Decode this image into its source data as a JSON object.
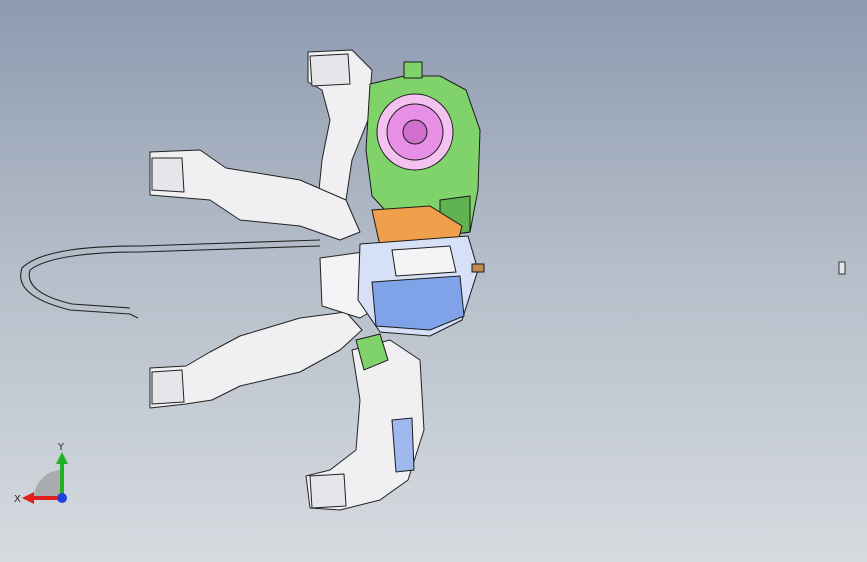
{
  "viewport": {
    "background_top": "#8e9bb0",
    "background_bottom": "#d7dbe0"
  },
  "model_colors": {
    "blower_housing": "#7fd36a",
    "blower_wheel": "#e88fe6",
    "core_blue": "#7fa2e8",
    "ducts": "#f0f0f2",
    "bracket_orange": "#f0a04a",
    "outline": "#222222"
  },
  "triad": {
    "x_label": "X",
    "y_label": "Y",
    "x_color": "#e02020",
    "y_color": "#20b020",
    "z_color": "#2040e0"
  }
}
